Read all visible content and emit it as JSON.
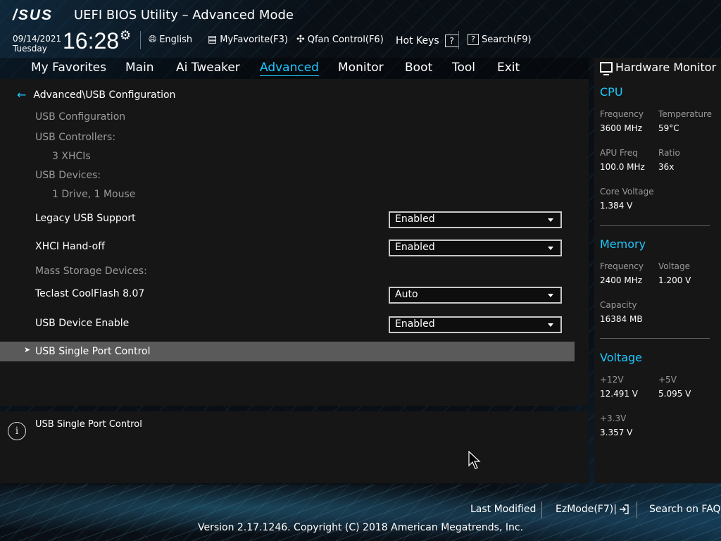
{
  "header": {
    "logo": "/SUS",
    "title": "UEFI BIOS Utility – Advanced Mode",
    "date": "09/14/2021",
    "day": "Tuesday",
    "time": "16:28",
    "tools": {
      "language": "English",
      "myfavorite": "MyFavorite(F3)",
      "qfan": "Qfan Control(F6)",
      "hotkeys": "Hot Keys",
      "hotkeys_badge": "?",
      "search": "Search(F9)",
      "search_badge": "?"
    }
  },
  "tabs": [
    "My Favorites",
    "Main",
    "Ai Tweaker",
    "Advanced",
    "Monitor",
    "Boot",
    "Tool",
    "Exit"
  ],
  "active_tab": "Advanced",
  "main": {
    "breadcrumb": "Advanced\\USB Configuration",
    "usb_configuration": "USB Configuration",
    "usb_controllers_label": "USB Controllers:",
    "usb_controllers_value": "3 XHCIs",
    "usb_devices_label": "USB Devices:",
    "usb_devices_value": "1 Drive, 1 Mouse",
    "legacy_usb_label": "Legacy USB Support",
    "legacy_usb_value": "Enabled",
    "xhci_label": "XHCI Hand-off",
    "xhci_value": "Enabled",
    "mass_storage_label": "Mass Storage Devices:",
    "teclast_label": "Teclast CoolFlash 8.07",
    "teclast_value": "Auto",
    "usb_device_enable_label": "USB Device Enable",
    "usb_device_enable_value": "Enabled",
    "usb_single_port": "USB Single Port Control"
  },
  "help": {
    "text": "USB Single Port Control"
  },
  "hardware_monitor": {
    "title": "Hardware Monitor",
    "cpu": {
      "heading": "CPU",
      "frequency_label": "Frequency",
      "frequency": "3600 MHz",
      "temperature_label": "Temperature",
      "temperature": "59°C",
      "apu_freq_label": "APU Freq",
      "apu_freq": "100.0 MHz",
      "ratio_label": "Ratio",
      "ratio": "36x",
      "core_voltage_label": "Core Voltage",
      "core_voltage": "1.384 V"
    },
    "memory": {
      "heading": "Memory",
      "frequency_label": "Frequency",
      "frequency": "2400 MHz",
      "voltage_label": "Voltage",
      "voltage": "1.200 V",
      "capacity_label": "Capacity",
      "capacity": "16384 MB"
    },
    "voltage": {
      "heading": "Voltage",
      "v12_label": "+12V",
      "v12": "12.491 V",
      "v5_label": "+5V",
      "v5": "5.095 V",
      "v33_label": "+3.3V",
      "v33": "3.357 V"
    }
  },
  "footer": {
    "last_modified": "Last Modified",
    "ezmode": "EzMode(F7)|",
    "search_faq": "Search on FAQ",
    "copyright": "Version 2.17.1246. Copyright (C) 2018 American Megatrends, Inc."
  },
  "colors": {
    "accent": "#1ec8ff",
    "panel": "#161616",
    "selected_row": "#5a5a5a"
  }
}
